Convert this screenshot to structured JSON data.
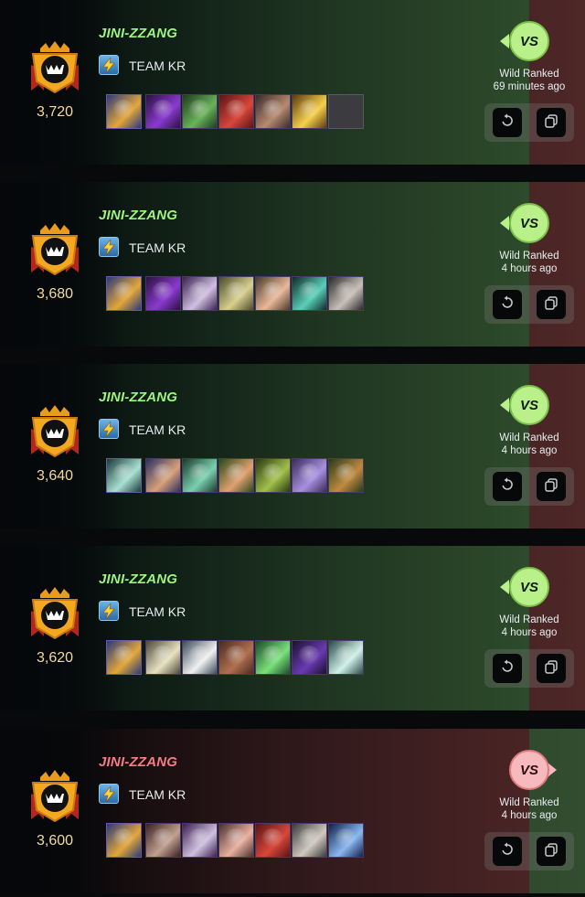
{
  "battles": [
    {
      "result": "win",
      "rating": "3,720",
      "player": "JINI-ZZANG",
      "guild": "TEAM KR",
      "mode": "Wild Ranked",
      "time": "69 minutes ago",
      "vs_label": "VS",
      "cards": [
        "summoner-warrior",
        "shadow-armor",
        "green-beast",
        "red-dragon",
        "bandit-rider",
        "golden-fire",
        "empty-slot"
      ],
      "card_colors": [
        [
          "#2a3a7a",
          "#e3a63a"
        ],
        [
          "#2b1040",
          "#8a3ad0"
        ],
        [
          "#1e3a1e",
          "#6ab35a"
        ],
        [
          "#5a1414",
          "#d8473a"
        ],
        [
          "#3a2a2a",
          "#b58a70"
        ],
        [
          "#5a3a10",
          "#f7d04a"
        ],
        [
          "#3b3b40",
          "#3b3b40"
        ]
      ]
    },
    {
      "result": "win",
      "rating": "3,680",
      "player": "JINI-ZZANG",
      "guild": "TEAM KR",
      "mode": "Wild Ranked",
      "time": "4 hours ago",
      "vs_label": "VS",
      "cards": [
        "summoner-warrior",
        "shadow-armor",
        "purple-knight",
        "feathered-beast",
        "winged-sprite",
        "teal-golem",
        "hooded-mystic"
      ],
      "card_colors": [
        [
          "#2a3a7a",
          "#e3a63a"
        ],
        [
          "#2b1040",
          "#8a3ad0"
        ],
        [
          "#3a2050",
          "#d0c0e0"
        ],
        [
          "#4a4a2a",
          "#d8d090"
        ],
        [
          "#4a3a2a",
          "#e9b89a"
        ],
        [
          "#0e2a2a",
          "#5ad0b8"
        ],
        [
          "#2a2a2a",
          "#c8c0b8"
        ]
      ]
    },
    {
      "result": "win",
      "rating": "3,640",
      "player": "JINI-ZZANG",
      "guild": "TEAM KR",
      "mode": "Wild Ranked",
      "time": "4 hours ago",
      "vs_label": "VS",
      "cards": [
        "earth-summoner",
        "wolf-rider",
        "green-serpent",
        "elf-druid",
        "forest-archer",
        "unicorn-mage",
        "goblin-rogue"
      ],
      "card_colors": [
        [
          "#1a3a3a",
          "#a8e0d0"
        ],
        [
          "#2a3060",
          "#d8a07a"
        ],
        [
          "#1a3a2a",
          "#7ad0b0"
        ],
        [
          "#2a4a1a",
          "#e0a070"
        ],
        [
          "#2a3a10",
          "#a0c04a"
        ],
        [
          "#3a2a5a",
          "#a890e0"
        ],
        [
          "#2a3a1a",
          "#c08a40"
        ]
      ]
    },
    {
      "result": "win",
      "rating": "3,620",
      "player": "JINI-ZZANG",
      "guild": "TEAM KR",
      "mode": "Wild Ranked",
      "time": "4 hours ago",
      "vs_label": "VS",
      "cards": [
        "summoner-warrior",
        "pale-dragon",
        "white-bird",
        "brown-beast",
        "green-plant",
        "shadow-ninja",
        "ice-spirit"
      ],
      "card_colors": [
        [
          "#2a3a7a",
          "#e3a63a"
        ],
        [
          "#4a4a3a",
          "#e8e0c0"
        ],
        [
          "#3a4a5a",
          "#f0f0f0"
        ],
        [
          "#4a2a20",
          "#b07050"
        ],
        [
          "#1a4a2a",
          "#7ae07a"
        ],
        [
          "#1a1030",
          "#6a3ab0"
        ],
        [
          "#2a4a4a",
          "#d0f0e8"
        ]
      ]
    },
    {
      "result": "loss",
      "rating": "3,600",
      "player": "JINI-ZZANG",
      "guild": "TEAM KR",
      "mode": "Wild Ranked",
      "time": "4 hours ago",
      "vs_label": "VS",
      "cards": [
        "summoner-warrior",
        "helmed-warrior",
        "purple-knight",
        "pink-brute",
        "red-dragon",
        "pale-wraith",
        "skull-spirit"
      ],
      "card_colors": [
        [
          "#2a3a7a",
          "#e3a63a"
        ],
        [
          "#3a2020",
          "#c0a090"
        ],
        [
          "#3a2050",
          "#d0c0e0"
        ],
        [
          "#4a3030",
          "#e8b0a0"
        ],
        [
          "#5a1414",
          "#d8473a"
        ],
        [
          "#3a3a3a",
          "#d0c8c0"
        ],
        [
          "#10204a",
          "#8ab8f0"
        ]
      ]
    }
  ],
  "colors": {
    "win_name": "#9df57d",
    "loss_name": "#f37d84",
    "rating": "#f3d9a0",
    "vs_win": "#b9f08a",
    "vs_loss": "#f6b9bd"
  },
  "icons": {
    "badge": "league-crown-badge-icon",
    "guild": "lightning-guild-icon",
    "replay": "replay-icon",
    "copy": "copy-team-icon"
  }
}
